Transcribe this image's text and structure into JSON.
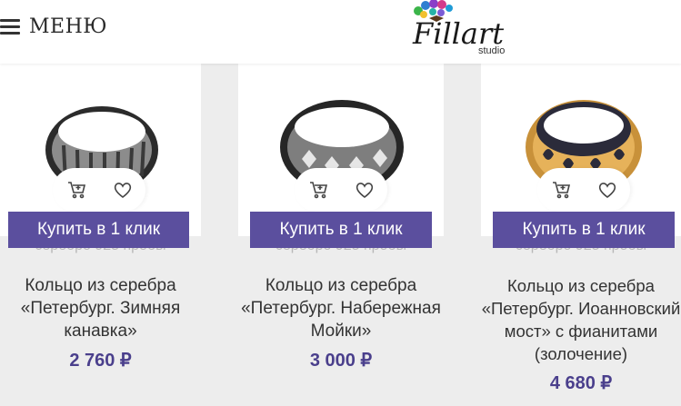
{
  "header": {
    "menu_label": "МЕНЮ",
    "logo_text": "Fillart",
    "logo_sub": "studio"
  },
  "products": [
    {
      "subtitle": "серебро 925 пробы",
      "buy_label": "Купить в 1 клик",
      "name": "Кольцо из серебра «Петербург. Зимняя канавка»",
      "price": "2 760 ₽"
    },
    {
      "subtitle": "серебро 925 пробы",
      "buy_label": "Купить в 1 клик",
      "name": "Кольцо из серебра «Петербург. Набережная Мойки»",
      "price": "3 000 ₽"
    },
    {
      "subtitle": "серебро 925 пробы",
      "buy_label": "Купить в 1 клик",
      "name": "Кольцо из серебра «Петербург. Иоанновский мост» с фианитами (золочение)",
      "price": "4 680 ₽"
    }
  ],
  "colors": {
    "accent": "#5b4f9e",
    "price": "#4a3f8c"
  },
  "icons": [
    "menu-icon",
    "cart-icon",
    "heart-icon"
  ]
}
